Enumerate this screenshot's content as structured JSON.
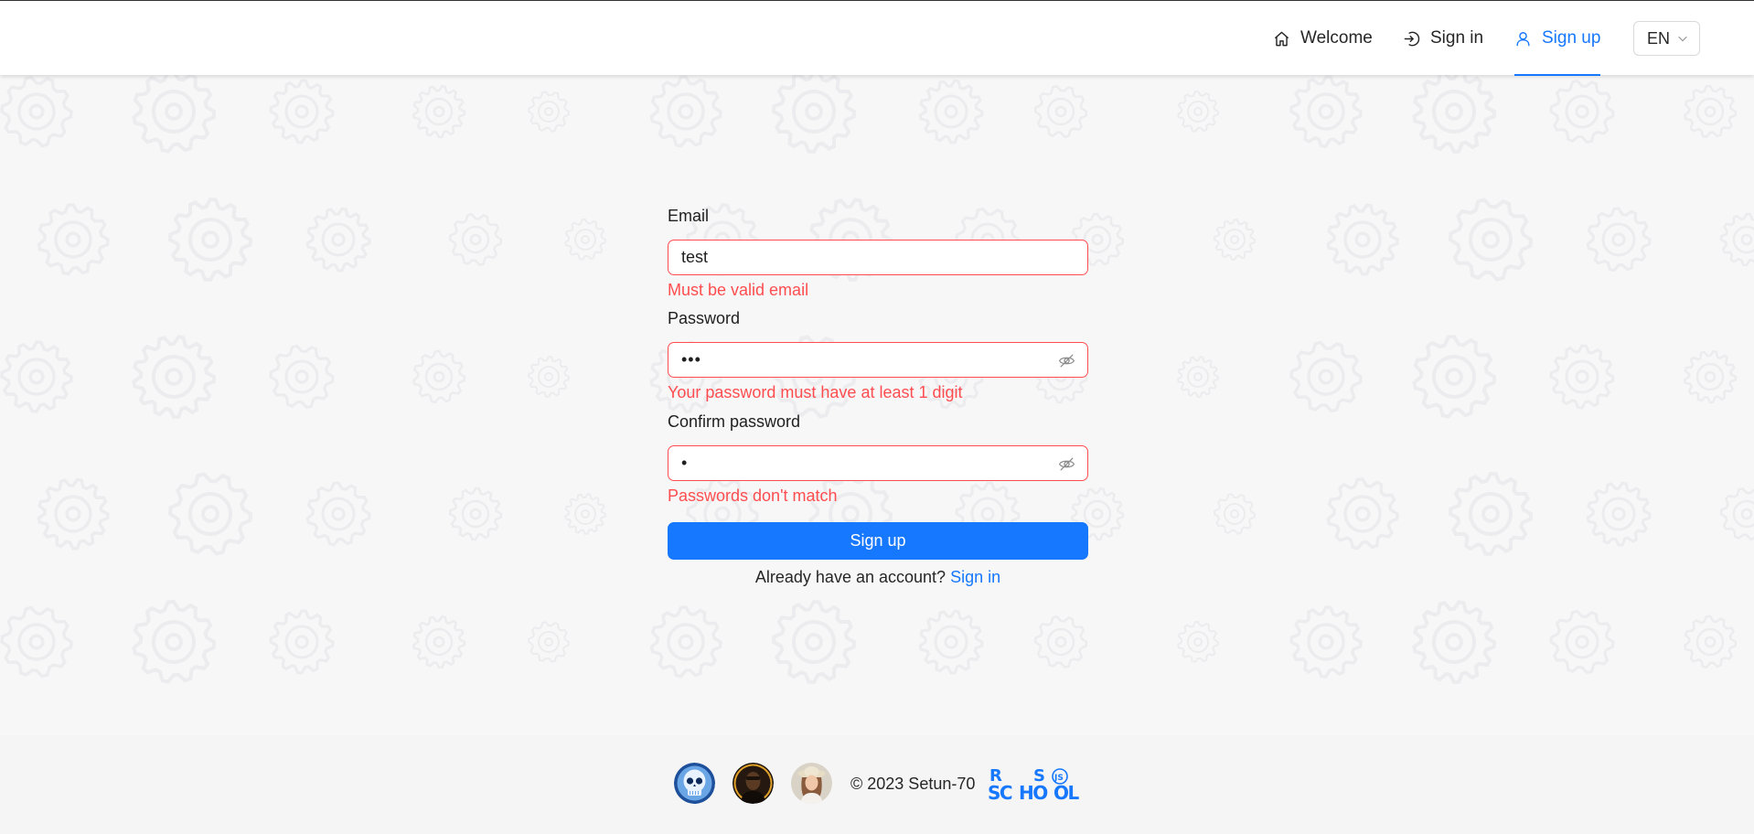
{
  "header": {
    "nav": [
      {
        "label": "Welcome",
        "icon": "home-icon",
        "active": false
      },
      {
        "label": "Sign in",
        "icon": "login-icon",
        "active": false
      },
      {
        "label": "Sign up",
        "icon": "user-icon",
        "active": true
      }
    ],
    "language": "EN"
  },
  "form": {
    "email": {
      "label": "Email",
      "value": "test",
      "error": "Must be valid email"
    },
    "password": {
      "label": "Password",
      "value_masked": "•••",
      "error": "Your password must have at least 1 digit"
    },
    "confirm_password": {
      "label": "Confirm password",
      "value_masked": "•",
      "error": "Passwords don't match"
    },
    "submit_label": "Sign up",
    "switch_text": "Already have an account?",
    "switch_link": "Sign in"
  },
  "footer": {
    "copyright": "© 2023 Setun-70",
    "logo_text": "RS SCHOOL JS"
  },
  "colors": {
    "accent": "#1677ff",
    "error": "#ff4d4f",
    "background": "#f7f7f8"
  }
}
